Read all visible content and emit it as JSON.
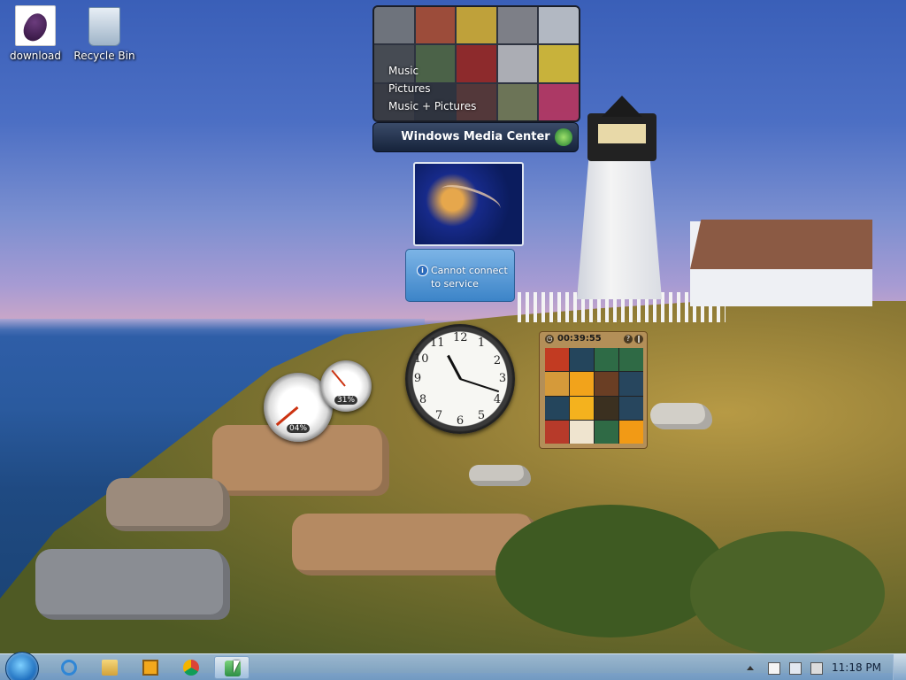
{
  "desktop": {
    "icons": [
      {
        "label": "download"
      },
      {
        "label": "Recycle Bin"
      }
    ]
  },
  "media_center": {
    "menu": [
      "Music",
      "Pictures",
      "Music + Pictures"
    ],
    "title": "Windows Media Center"
  },
  "weather": {
    "message_line1": "Cannot connect",
    "message_line2": "to service"
  },
  "clock": {
    "numbers": [
      "12",
      "1",
      "2",
      "3",
      "4",
      "5",
      "6",
      "7",
      "8",
      "9",
      "10",
      "11"
    ]
  },
  "cpu_meter": {
    "cpu_percent_label": "04%",
    "memory_percent_label": "31%",
    "cpu_value": 4,
    "memory_value": 31
  },
  "puzzle": {
    "timer": "00:39:55"
  },
  "taskbar": {
    "apps": [
      "internet-explorer-icon",
      "windows-explorer-icon",
      "media-player-icon",
      "chrome-icon",
      "network-app-icon"
    ],
    "clock": "11:18 PM"
  }
}
